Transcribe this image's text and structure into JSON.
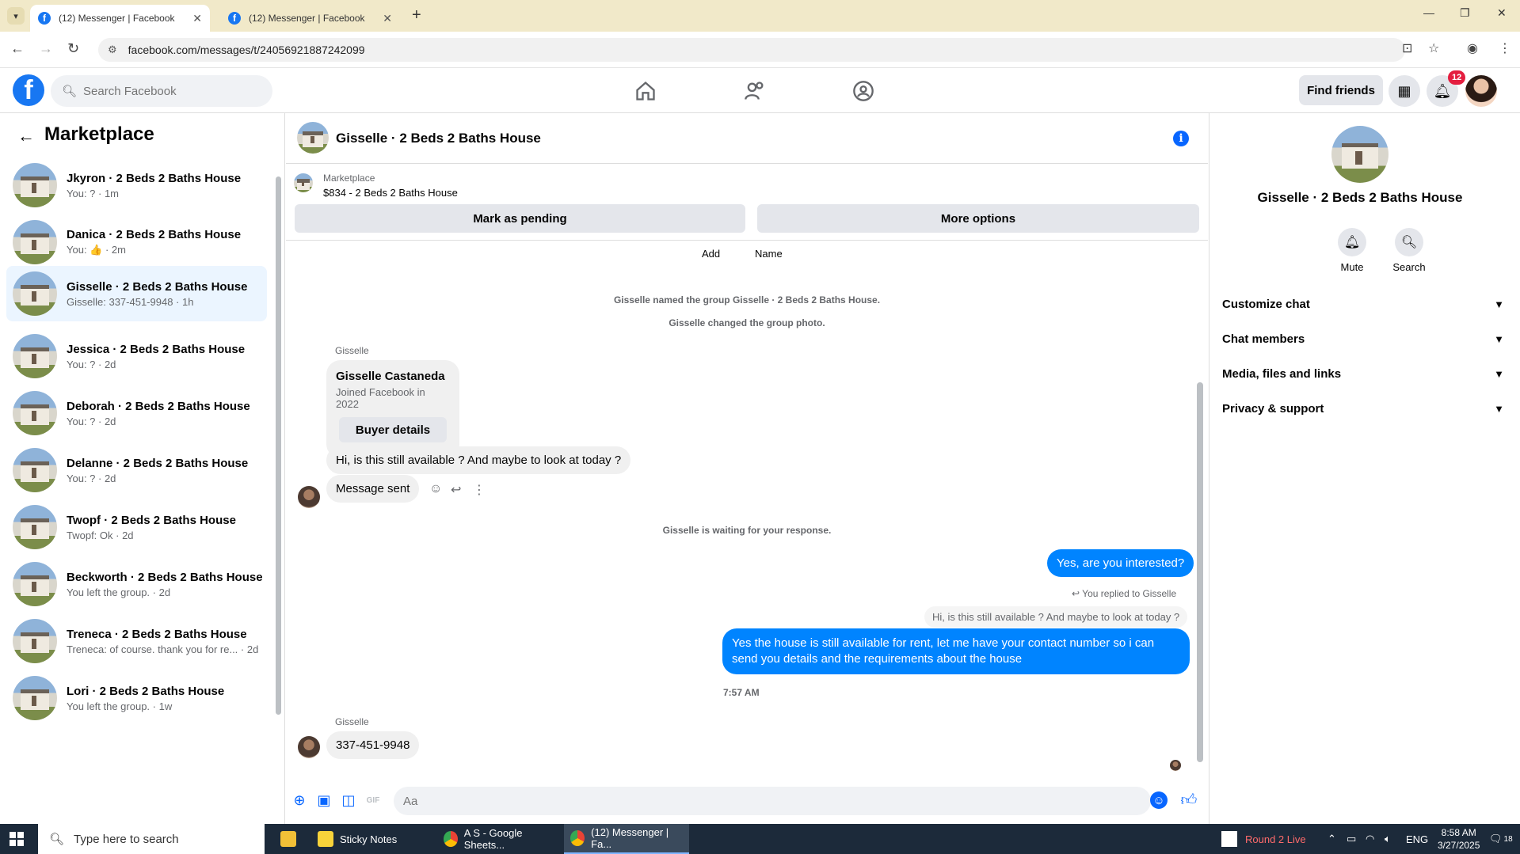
{
  "browser": {
    "tabs": [
      {
        "title": "(12) Messenger | Facebook",
        "active": true
      },
      {
        "title": "(12) Messenger | Facebook",
        "active": false
      }
    ],
    "url": "facebook.com/messages/t/24056921887242099"
  },
  "fb_header": {
    "search_placeholder": "Search Facebook",
    "find_friends_label": "Find friends",
    "notification_count": "12",
    "brand_color": "#1877f2"
  },
  "sidebar": {
    "title": "Marketplace",
    "conversations": [
      {
        "name": "Jkyron · 2 Beds 2 Baths House",
        "preview": "You: ? · 1m",
        "active": false
      },
      {
        "name": "Danica · 2 Beds 2 Baths House",
        "preview": "You: 👍 · 2m",
        "active": false
      },
      {
        "name": "Gisselle · 2 Beds 2 Baths House",
        "preview": "Gisselle: 337-451-9948 · 1h",
        "active": true
      },
      {
        "name": "Jessica · 2 Beds 2 Baths House",
        "preview": "You: ? · 2d",
        "active": false
      },
      {
        "name": "Deborah · 2 Beds 2 Baths House",
        "preview": "You: ? · 2d",
        "active": false
      },
      {
        "name": "Delanne · 2 Beds 2 Baths House",
        "preview": "You: ? · 2d",
        "active": false
      },
      {
        "name": "Twopf · 2 Beds 2 Baths House",
        "preview": "Twopf: Ok · 2d",
        "active": false
      },
      {
        "name": "Beckworth · 2 Beds 2 Baths House",
        "preview": "You left the group. · 2d",
        "active": false
      },
      {
        "name": "Treneca · 2 Beds 2 Baths House",
        "preview": "Treneca: of course. thank you for re... · 2d",
        "active": false
      },
      {
        "name": "Lori · 2 Beds 2 Baths House",
        "preview": "You left the group. · 1w",
        "active": false
      }
    ]
  },
  "chat": {
    "title": "Gisselle · 2 Beds 2 Baths House",
    "marketplace_label": "Marketplace",
    "listing": "$834 - 2 Beds 2 Baths House",
    "mark_pending_label": "Mark as pending",
    "more_options_label": "More options",
    "add_label": "Add",
    "name_label": "Name",
    "system_1": "Gisselle named the group Gisselle · 2 Beds 2 Baths House.",
    "system_2": "Gisselle changed the group photo.",
    "sender_1": "Gisselle",
    "profile_name": "Gisselle Castaneda",
    "profile_joined": "Joined Facebook in 2022",
    "buyer_details_label": "Buyer details",
    "msg_in_1": "Hi, is this still available ? And maybe to look at today ?",
    "msg_in_2": "Message sent",
    "waiting": "Gisselle is waiting for your response.",
    "msg_out_1": "Yes, are you interested?",
    "replied_label": "You replied to Gisselle",
    "quoted": "Hi, is this still available ? And maybe to look at today ?",
    "msg_out_2": "Yes the house is still available for rent, let me have your contact number so i can send you details and the requirements about the house",
    "time": "7:57 AM",
    "sender_2": "Gisselle",
    "msg_in_3": "337-451-9948",
    "composer_placeholder": "Aa",
    "accent_color": "#0084ff"
  },
  "right_panel": {
    "name": "Gisselle · 2 Beds 2 Baths House",
    "mute_label": "Mute",
    "search_label": "Search",
    "sections": [
      "Customize chat",
      "Chat members",
      "Media, files and links",
      "Privacy & support"
    ]
  },
  "taskbar": {
    "search_placeholder": "Type here to search",
    "apps": [
      {
        "label": "Sticky Notes",
        "active": false
      },
      {
        "label": "A S - Google Sheets...",
        "active": false
      },
      {
        "label": "(12) Messenger | Fa...",
        "active": true
      }
    ],
    "news": "Round 2 Live",
    "lang": "ENG",
    "time": "8:58 AM",
    "date": "3/27/2025",
    "notif_count": "18"
  }
}
